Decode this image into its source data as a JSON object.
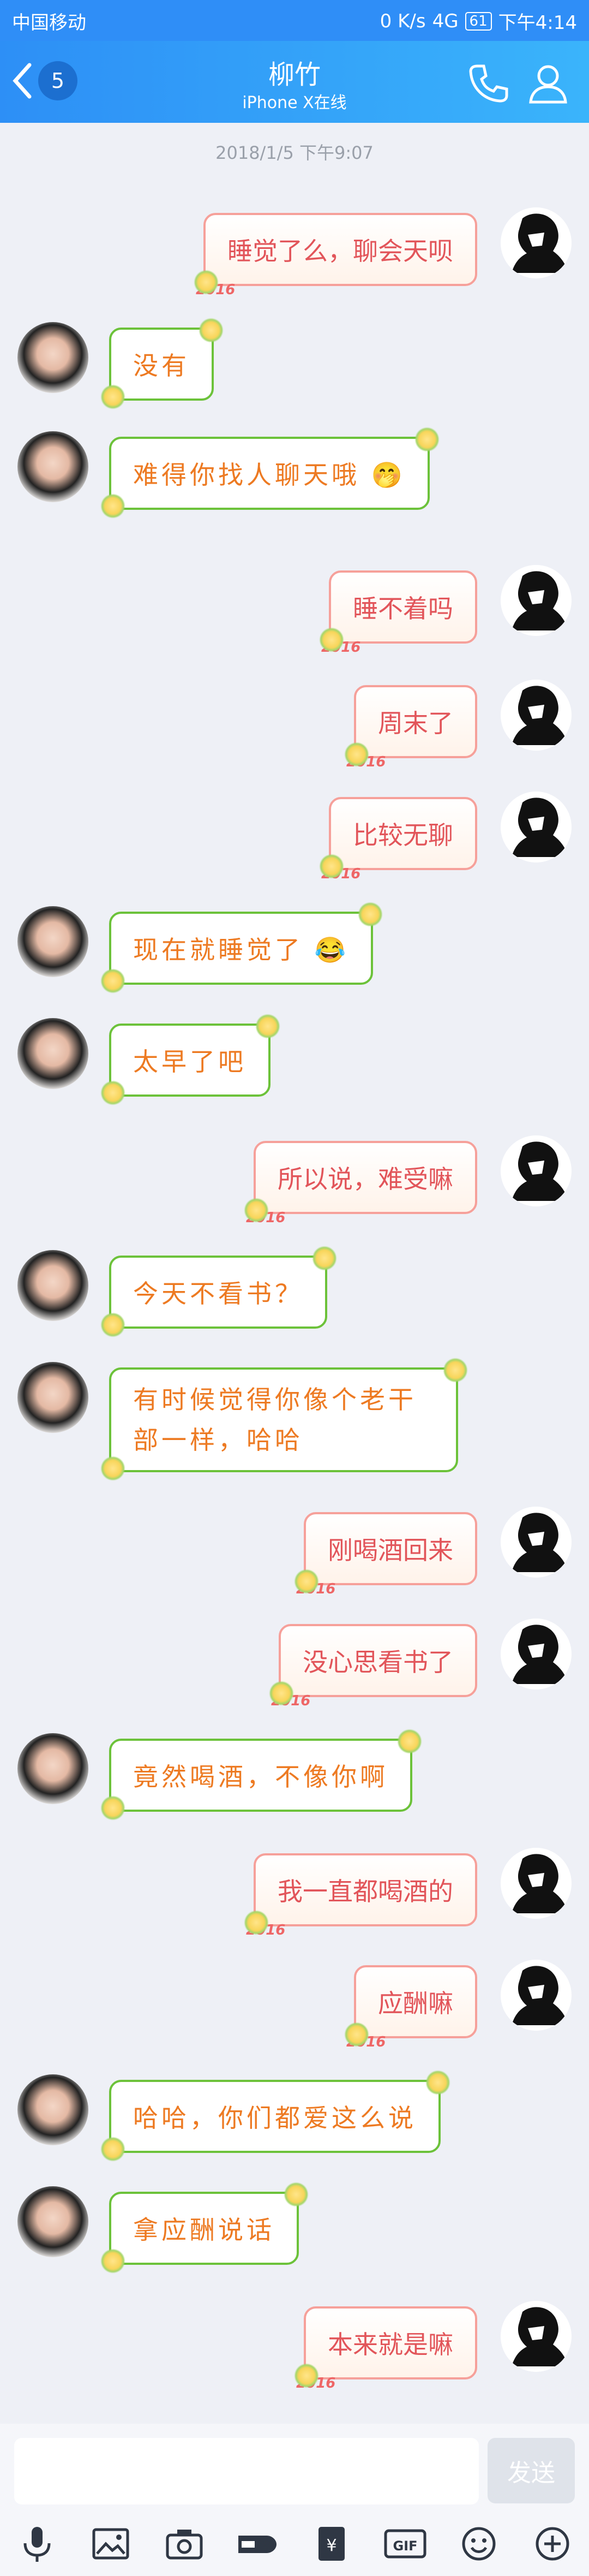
{
  "status": {
    "carrier": "中国移动",
    "speed": "0 K/s",
    "network": "4G",
    "battery": "61",
    "time": "下午4:14"
  },
  "header": {
    "unread": "5",
    "title": "柳竹",
    "subtitle": "iPhone X在线"
  },
  "timestamp": "2018/1/5 下午9:07",
  "messages": [
    {
      "from": "me",
      "text": "睡觉了么，聊会天呗"
    },
    {
      "from": "her",
      "text": "没有"
    },
    {
      "from": "her",
      "text": "难得你找人聊天哦 🤭"
    },
    {
      "from": "me",
      "text": "睡不着吗"
    },
    {
      "from": "me",
      "text": "周末了"
    },
    {
      "from": "me",
      "text": "比较无聊"
    },
    {
      "from": "her",
      "text": "现在就睡觉了 😂"
    },
    {
      "from": "her",
      "text": "太早了吧"
    },
    {
      "from": "me",
      "text": "所以说，难受嘛"
    },
    {
      "from": "her",
      "text": "今天不看书？"
    },
    {
      "from": "her",
      "text": "有时候觉得你像个老干部一样，哈哈"
    },
    {
      "from": "me",
      "text": "刚喝酒回来"
    },
    {
      "from": "me",
      "text": "没心思看书了"
    },
    {
      "from": "her",
      "text": "竟然喝酒，不像你啊"
    },
    {
      "from": "me",
      "text": "我一直都喝酒的"
    },
    {
      "from": "me",
      "text": "应酬嘛"
    },
    {
      "from": "her",
      "text": "哈哈，你们都爱这么说"
    },
    {
      "from": "her",
      "text": "拿应酬说话"
    },
    {
      "from": "me",
      "text": "本来就是嘛"
    }
  ],
  "bubble_tag": "2016",
  "input": {
    "placeholder": "",
    "send_label": "发送"
  },
  "toolbar": [
    "mic-icon",
    "image-icon",
    "camera-icon",
    "hongbao-icon",
    "redpacket-icon",
    "gif-icon",
    "emoji-icon",
    "plus-icon"
  ]
}
